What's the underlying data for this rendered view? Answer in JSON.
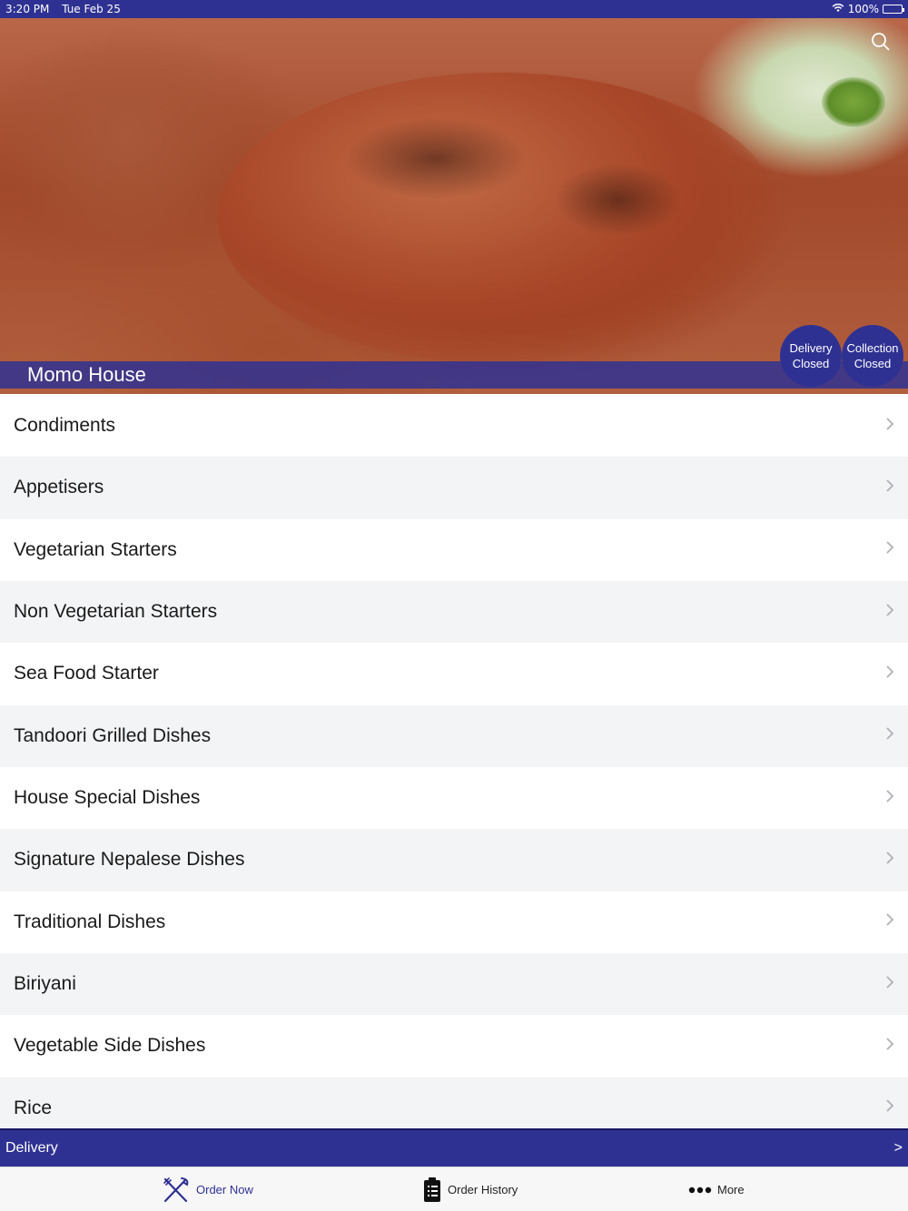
{
  "status_bar": {
    "time": "3:20 PM",
    "date": "Tue Feb 25",
    "battery": "100%"
  },
  "header": {
    "shop_name": "Momo House",
    "search_icon": "search-icon"
  },
  "badges": {
    "delivery": {
      "line1": "Delivery",
      "line2": "Closed"
    },
    "collection": {
      "line1": "Collection",
      "line2": "Closed"
    }
  },
  "categories": [
    {
      "label": "Condiments"
    },
    {
      "label": "Appetisers"
    },
    {
      "label": "Vegetarian Starters"
    },
    {
      "label": "Non Vegetarian Starters"
    },
    {
      "label": "Sea Food Starter"
    },
    {
      "label": "Tandoori Grilled Dishes"
    },
    {
      "label": "House Special Dishes"
    },
    {
      "label": "Signature Nepalese Dishes"
    },
    {
      "label": "Traditional Dishes"
    },
    {
      "label": "Biriyani"
    },
    {
      "label": "Vegetable Side Dishes"
    },
    {
      "label": "Rice"
    }
  ],
  "delivery_bar": {
    "label": "Delivery",
    "arrow": ">"
  },
  "tabs": {
    "order_now": "Order Now",
    "order_history": "Order History",
    "more": "More"
  },
  "colors": {
    "brand": "#2f3192",
    "row_alt": "#f3f4f6"
  }
}
